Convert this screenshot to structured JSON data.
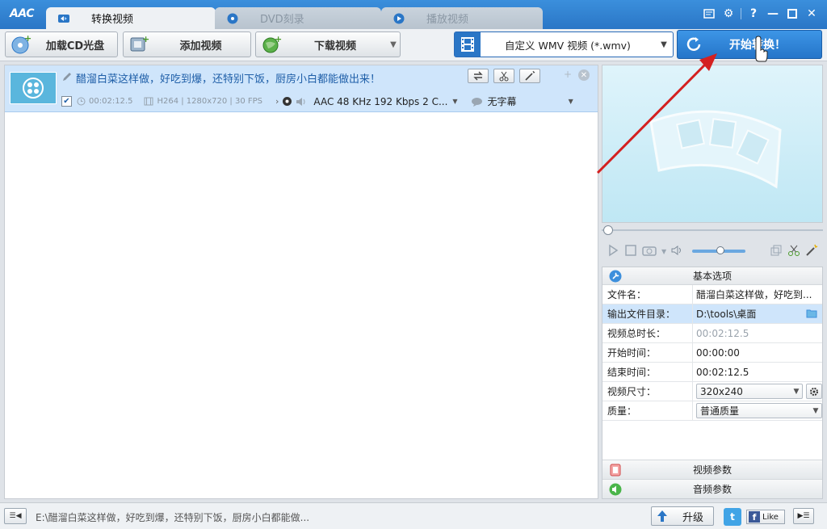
{
  "app": {
    "logo": "AAC"
  },
  "tabs": [
    {
      "label": "转换视频",
      "active": true
    },
    {
      "label": "DVD刻录",
      "active": false
    },
    {
      "label": "播放视频",
      "active": false
    }
  ],
  "toolbar": {
    "load_cd": "加载CD光盘",
    "add_video": "添加视频",
    "download_video": "下载视频",
    "format": "自定义 WMV 视频 (*.wmv)",
    "start": "开始转换！"
  },
  "item": {
    "title": "醋溜白菜这样做，好吃到爆，还特别下饭，厨房小白都能做出来！",
    "duration": "00:02:12.5",
    "video_info": "H264 | 1280x720 | 30 FPS",
    "audio": "AAC 48 KHz 192 Kbps 2 C...",
    "subtitle": "无字幕",
    "checked": true
  },
  "props": {
    "header": "基本选项",
    "rows": [
      {
        "key": "文件名：",
        "value": "醋溜白菜这样做，好吃到..."
      },
      {
        "key": "输出文件目录：",
        "value": "D:\\tools\\桌面"
      },
      {
        "key": "视频总时长：",
        "value": "00:02:12.5"
      },
      {
        "key": "开始时间：",
        "value": "00:00:00"
      },
      {
        "key": "结束时间：",
        "value": "00:02:12.5"
      },
      {
        "key": "视频尺寸：",
        "value": "320x240"
      },
      {
        "key": "质量：",
        "value": "普通质量"
      }
    ],
    "video_params": "视频参数",
    "audio_params": "音频参数"
  },
  "status": {
    "path": "E:\\醋溜白菜这样做，好吃到爆，还特别下饭，厨房小白都能做...",
    "upgrade": "升级",
    "like": "Like"
  },
  "colors": {
    "accent": "#2a76c6",
    "selection": "#cfe5fb",
    "arrow": "#d42020"
  }
}
